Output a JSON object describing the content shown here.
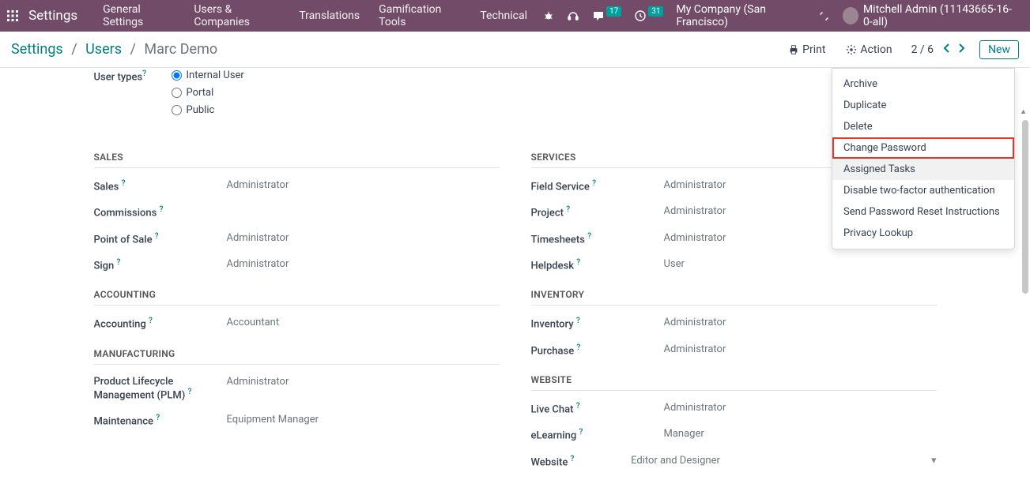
{
  "topbar": {
    "brand": "Settings",
    "menu": [
      "General Settings",
      "Users & Companies",
      "Translations",
      "Gamification Tools",
      "Technical"
    ],
    "messages_badge": "17",
    "activities_badge": "31",
    "company": "My Company (San Francisco)",
    "user": "Mitchell Admin (11143665-16-0-all)"
  },
  "breadcrumb": {
    "root": "Settings",
    "mid": "Users",
    "leaf": "Marc Demo"
  },
  "toolbar": {
    "print": "Print",
    "action": "Action",
    "pager": "2 / 6",
    "new": "New"
  },
  "action_menu": [
    "Archive",
    "Duplicate",
    "Delete",
    "Change Password",
    "Assigned Tasks",
    "Disable two-factor authentication",
    "Send Password Reset Instructions",
    "Privacy Lookup"
  ],
  "user_types": {
    "label": "User types",
    "options": [
      "Internal User",
      "Portal",
      "Public"
    ],
    "selected": 0
  },
  "left_sections": [
    {
      "title": "SALES",
      "fields": [
        {
          "label": "Sales",
          "value": "Administrator"
        },
        {
          "label": "Commissions",
          "value": ""
        },
        {
          "label": "Point of Sale",
          "value": "Administrator"
        },
        {
          "label": "Sign",
          "value": "Administrator"
        }
      ]
    },
    {
      "title": "ACCOUNTING",
      "fields": [
        {
          "label": "Accounting",
          "value": "Accountant"
        }
      ]
    },
    {
      "title": "MANUFACTURING",
      "fields": [
        {
          "label": "Product Lifecycle Management (PLM)",
          "value": "Administrator"
        },
        {
          "label": "Maintenance",
          "value": "Equipment Manager"
        }
      ]
    }
  ],
  "right_sections": [
    {
      "title": "SERVICES",
      "fields": [
        {
          "label": "Field Service",
          "value": "Administrator"
        },
        {
          "label": "Project",
          "value": "Administrator"
        },
        {
          "label": "Timesheets",
          "value": "Administrator"
        },
        {
          "label": "Helpdesk",
          "value": "User"
        }
      ]
    },
    {
      "title": "INVENTORY",
      "fields": [
        {
          "label": "Inventory",
          "value": "Administrator"
        },
        {
          "label": "Purchase",
          "value": "Administrator"
        }
      ]
    },
    {
      "title": "WEBSITE",
      "fields": [
        {
          "label": "Live Chat",
          "value": "Administrator"
        },
        {
          "label": "eLearning",
          "value": "Manager"
        },
        {
          "label": "Website",
          "value": "Editor and Designer",
          "select": true
        }
      ]
    }
  ]
}
